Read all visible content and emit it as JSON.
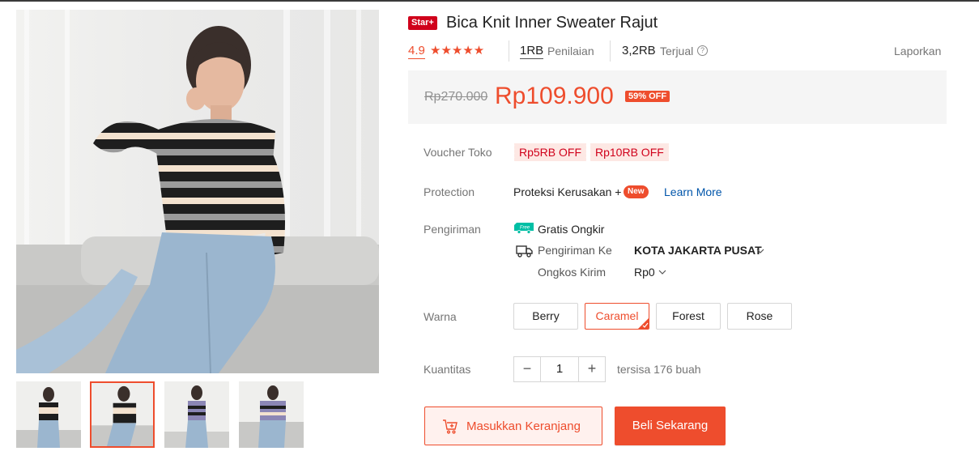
{
  "product": {
    "badge": "Star+",
    "title": "Bica Knit Inner Sweater Rajut",
    "rating": "4.9",
    "stars": "★★★★★",
    "reviews_count": "1RB",
    "reviews_label": "Penilaian",
    "sold_count": "3,2RB",
    "sold_label": "Terjual",
    "help_icon": "?",
    "report": "Laporkan"
  },
  "price": {
    "original": "Rp270.000",
    "current": "Rp109.900",
    "discount": "59% OFF"
  },
  "voucher": {
    "label": "Voucher Toko",
    "items": [
      "Rp5RB OFF",
      "Rp10RB OFF"
    ]
  },
  "protection": {
    "label": "Protection",
    "text": "Proteksi Kerusakan +",
    "badge": "New",
    "link": "Learn More"
  },
  "shipping": {
    "label": "Pengiriman",
    "free_icon_text": "Free",
    "free_label": "Gratis Ongkir",
    "to_label": "Pengiriman Ke",
    "city": "KOTA JAKARTA PUSAT",
    "cost_label": "Ongkos Kirim",
    "cost": "Rp0"
  },
  "color": {
    "label": "Warna",
    "options": [
      "Berry",
      "Caramel",
      "Forest",
      "Rose"
    ],
    "selected": "Caramel"
  },
  "quantity": {
    "label": "Kuantitas",
    "minus": "−",
    "value": "1",
    "plus": "+",
    "stock": "tersisa 176 buah"
  },
  "actions": {
    "add_to_cart": "Masukkan Keranjang",
    "buy_now": "Beli Sekarang"
  },
  "colors": {
    "accent": "#ee4d2d",
    "star_badge": "#d0011b",
    "link": "#0055aa",
    "price_bg": "#f5f5f5"
  },
  "icons": [
    "product-main-image",
    "thumbnail-image",
    "star-icon",
    "help-icon",
    "free-shipping-icon",
    "truck-icon",
    "chevron-down-icon",
    "check-icon",
    "add-to-cart-icon"
  ]
}
